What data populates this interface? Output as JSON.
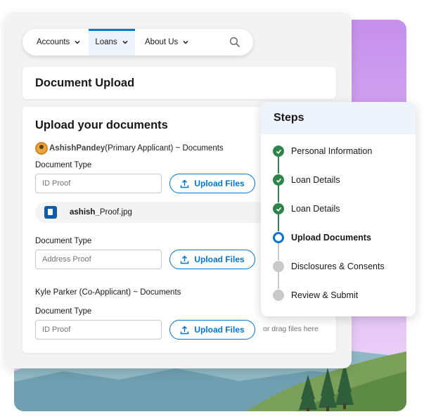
{
  "nav": {
    "items": [
      {
        "label": "Accounts"
      },
      {
        "label": "Loans",
        "active": true
      },
      {
        "label": "About Us"
      }
    ],
    "search_icon": "search-icon"
  },
  "page": {
    "title": "Document Upload"
  },
  "upload": {
    "heading": "Upload your documents",
    "primary_applicant": {
      "name": "AshishPandey",
      "suffix": "(Primary Applicant) ~ Documents"
    },
    "co_applicant_label": "Kyle Parker (Co-Applicant) ~ Documents",
    "document_type_label": "Document Type",
    "upload_button_label": "Upload Files",
    "fields": [
      {
        "value": "ID Proof"
      },
      {
        "value": "Address Proof"
      },
      {
        "value": "ID Proof"
      }
    ],
    "file": {
      "name_bold": "ashish_",
      "name_rest": "Proof.jpg"
    },
    "drag_hint": "or drag files here"
  },
  "steps": {
    "title": "Steps",
    "items": [
      {
        "label": "Personal Information",
        "status": "done"
      },
      {
        "label": "Loan Details",
        "status": "done"
      },
      {
        "label": "Loan Details",
        "status": "done"
      },
      {
        "label": "Upload Documents",
        "status": "current"
      },
      {
        "label": "Disclosures & Consents",
        "status": "todo"
      },
      {
        "label": "Review & Submit",
        "status": "todo"
      }
    ]
  },
  "colors": {
    "brand_blue": "#0176d3",
    "success_green": "#2e844a",
    "pending_gray": "#c9c9c9",
    "background_purple": "#d9a8f2"
  }
}
